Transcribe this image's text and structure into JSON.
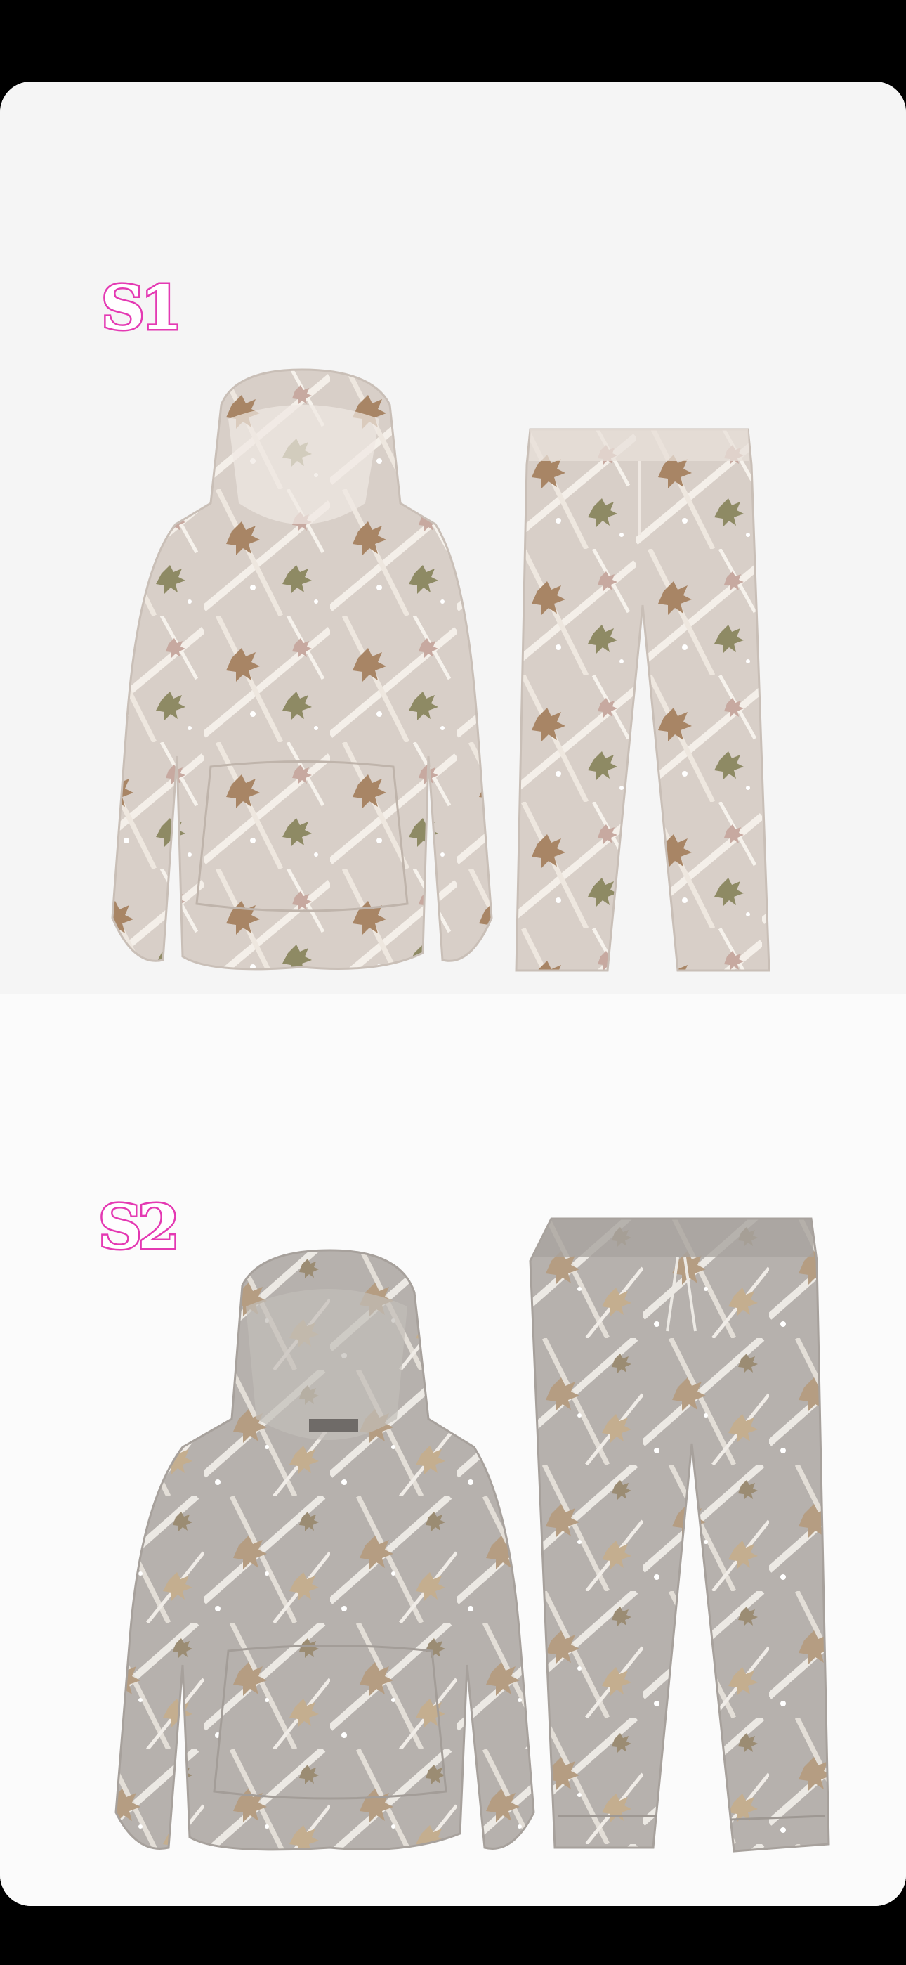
{
  "photo": {
    "background_color": "#000000",
    "card_color": "#ffffff",
    "sets": [
      {
        "label": "S1",
        "label_color": "#e43ab3",
        "description": "hoodie-and-pants-light-camo",
        "base_color": "#d8cfc8",
        "branch_color": "#f4efe9",
        "leaf_colors": [
          "#a88565",
          "#b59b7a",
          "#8e8a64",
          "#c7a9a0"
        ]
      },
      {
        "label": "S2",
        "label_color": "#e43ab3",
        "description": "hoodie-and-joggers-grey-camo",
        "base_color": "#b6b1ad",
        "branch_color": "#ece9e4",
        "leaf_colors": [
          "#b59d82",
          "#c4ae8f",
          "#9b8c73",
          "#d2c0a2"
        ]
      }
    ]
  }
}
